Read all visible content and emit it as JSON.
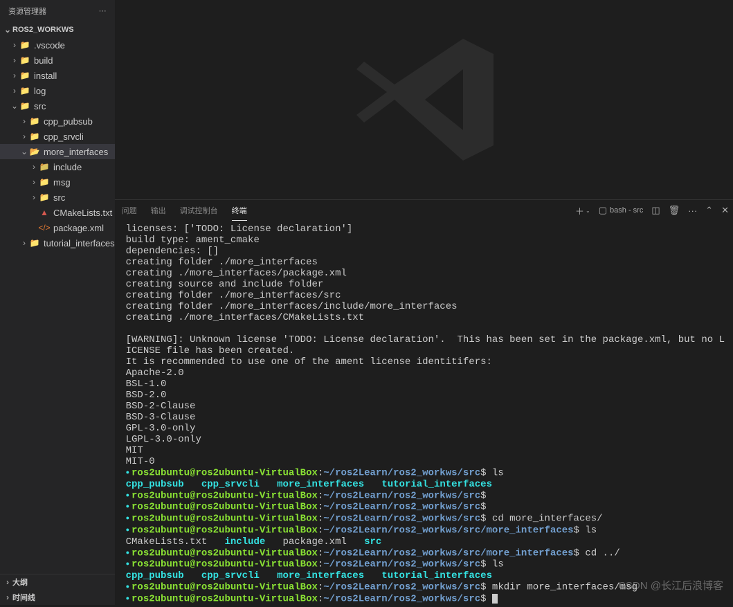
{
  "sidebar": {
    "title": "资源管理器",
    "root_label": "ROS2_WORKWS",
    "nodes": {
      "vscode": ".vscode",
      "build": "build",
      "install": "install",
      "log": "log",
      "src": "src",
      "cpp_pubsub": "cpp_pubsub",
      "cpp_srvcli": "cpp_srvcli",
      "more_interfaces": "more_interfaces",
      "include": "include",
      "msg": "msg",
      "src_inner": "src",
      "cmakelists": "CMakeLists.txt",
      "packagexml": "package.xml",
      "tutorial_interfaces": "tutorial_interfaces"
    },
    "footer_outline": "大纲",
    "footer_timeline": "时间线"
  },
  "panel": {
    "tabs": {
      "problems": "问题",
      "output": "输出",
      "debug": "调试控制台",
      "terminal": "终端"
    },
    "profile": "bash - src",
    "tools": {
      "new": "+",
      "split": "▯▯",
      "trash": "🗑"
    }
  },
  "terminal": {
    "intro": [
      "licenses: ['TODO: License declaration']",
      "build type: ament_cmake",
      "dependencies: []",
      "creating folder ./more_interfaces",
      "creating ./more_interfaces/package.xml",
      "creating source and include folder",
      "creating folder ./more_interfaces/src",
      "creating folder ./more_interfaces/include/more_interfaces",
      "creating ./more_interfaces/CMakeLists.txt",
      "",
      "[WARNING]: Unknown license 'TODO: License declaration'.  This has been set in the package.xml, but no L",
      "ICENSE file has been created.",
      "It is recommended to use one of the ament license identitifers:",
      "Apache-2.0",
      "BSL-1.0",
      "BSD-2.0",
      "BSD-2-Clause",
      "BSD-3-Clause",
      "GPL-3.0-only",
      "LGPL-3.0-only",
      "MIT",
      "MIT-0"
    ],
    "user": "ros2ubuntu@ros2ubuntu-VirtualBox",
    "path_src": "~/ros2Learn/ros2_workws/src",
    "path_more": "~/ros2Learn/ros2_workws/src/more_interfaces",
    "dirs": [
      "cpp_pubsub",
      "cpp_srvcli",
      "more_interfaces",
      "tutorial_interfaces"
    ],
    "ls_more_files": [
      "CMakeLists.txt",
      "include",
      "package.xml",
      "src"
    ],
    "cmds": {
      "ls": "ls",
      "cd_more": "cd more_interfaces/",
      "cd_up": "cd ../",
      "mkdir": "mkdir more_interfaces/msg"
    }
  },
  "watermark": "CSDN @长江后浪博客"
}
